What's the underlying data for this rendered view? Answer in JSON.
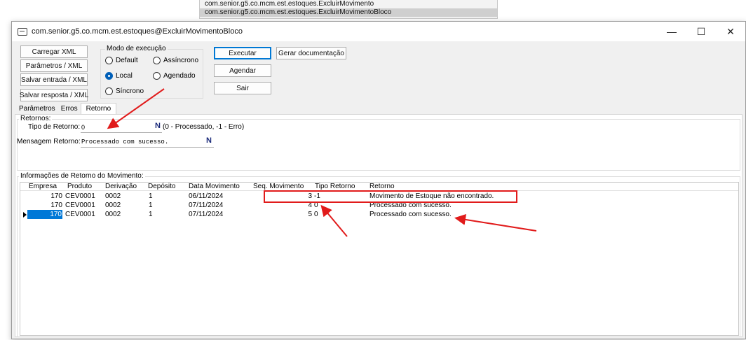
{
  "background_list": {
    "items": [
      "com.senior.g5.co.mcm.est.estoques.ExcluirMovimento",
      "com.senior.g5.co.mcm.est.estoques.ExcluirMovimentoBloco"
    ]
  },
  "window": {
    "title": "com.senior.g5.co.mcm.est.estoques@ExcluirMovimentoBloco",
    "minimize": "—",
    "maximize": "☐",
    "close": "✕"
  },
  "left_buttons": {
    "carregar_xml": "Carregar XML",
    "parametros_xml": "Parâmetros / XML",
    "salvar_entrada": "Salvar entrada / XML",
    "salvar_resposta": "Salvar resposta / XML"
  },
  "modo_execucao": {
    "title": "Modo de execução",
    "options": {
      "default": "Default",
      "assincrono": "Assíncrono",
      "local": "Local",
      "agendado": "Agendado",
      "sincrono": "Síncrono"
    },
    "selected": "Local"
  },
  "action_buttons": {
    "executar": "Executar",
    "gerar_documentacao": "Gerar documentação",
    "agendar": "Agendar",
    "sair": "Sair"
  },
  "tabs": [
    "Parâmetros",
    "Erros",
    "Retorno"
  ],
  "active_tab": "Retorno",
  "retornos": {
    "title": "Retornos:",
    "tipo_label": "Tipo de Retorno:",
    "tipo_value": "0",
    "tipo_badge": "N",
    "tipo_hint": "(0 - Processado, -1 - Erro)",
    "mensagem_label": "Mensagem Retorno:",
    "mensagem_value": "Processado com sucesso.",
    "mensagem_badge": "N"
  },
  "grid": {
    "title": "Informações de Retorno do Movimento:",
    "columns": [
      "Empresa",
      "Produto",
      "Derivação",
      "Depósito",
      "Data Movimento",
      "Seq. Movimento",
      "Tipo Retorno",
      "Retorno"
    ],
    "rows": [
      [
        "170",
        "CEV0001",
        "0002",
        "1",
        "06/11/2024",
        "3",
        "-1",
        "Movimento de Estoque não encontrado."
      ],
      [
        "170",
        "CEV0001",
        "0002",
        "1",
        "07/11/2024",
        "4",
        "0",
        "Processado com sucesso."
      ],
      [
        "170",
        "CEV0001",
        "0002",
        "1",
        "07/11/2024",
        "5",
        "0",
        "Processado com sucesso."
      ]
    ]
  },
  "colors": {
    "annotation_red": "#e11b1b",
    "selection_blue": "#0078d7",
    "badge_navy": "#1a2a7a"
  }
}
